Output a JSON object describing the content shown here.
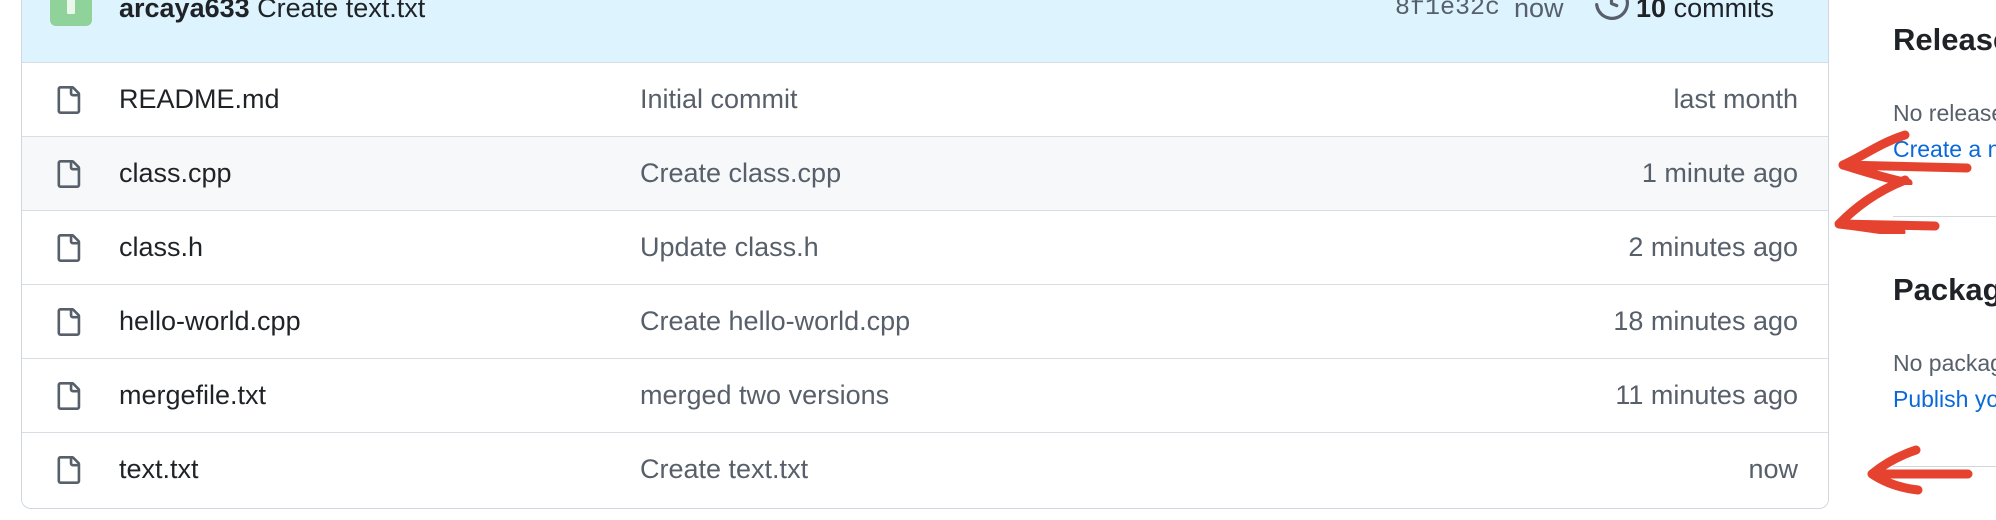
{
  "commit_bar": {
    "author": "arcaya633",
    "message": "Create text.txt",
    "sha": "8f1e32c",
    "time": "now",
    "commits_count": "10",
    "commits_label": "commits"
  },
  "files": [
    {
      "name": "README.md",
      "message": "Initial commit",
      "age": "last month"
    },
    {
      "name": "class.cpp",
      "message": "Create class.cpp",
      "age": "1 minute ago"
    },
    {
      "name": "class.h",
      "message": "Update class.h",
      "age": "2 minutes ago"
    },
    {
      "name": "hello-world.cpp",
      "message": "Create hello-world.cpp",
      "age": "18 minutes ago"
    },
    {
      "name": "mergefile.txt",
      "message": "merged two versions",
      "age": "11 minutes ago"
    },
    {
      "name": "text.txt",
      "message": "Create text.txt",
      "age": "now"
    }
  ],
  "sidebar": {
    "releases": {
      "heading": "Releases",
      "text": "No releases published",
      "link": "Create a new release"
    },
    "packages": {
      "heading": "Packages",
      "text": "No packages published",
      "link": "Publish your first package"
    }
  },
  "icons": {
    "file": "file-icon",
    "history": "history-icon",
    "annotation": "red-arrow-icon"
  },
  "colors": {
    "commit_bar_bg": "#ddf4ff",
    "link": "#0969da",
    "annotation": "#e5432f"
  }
}
